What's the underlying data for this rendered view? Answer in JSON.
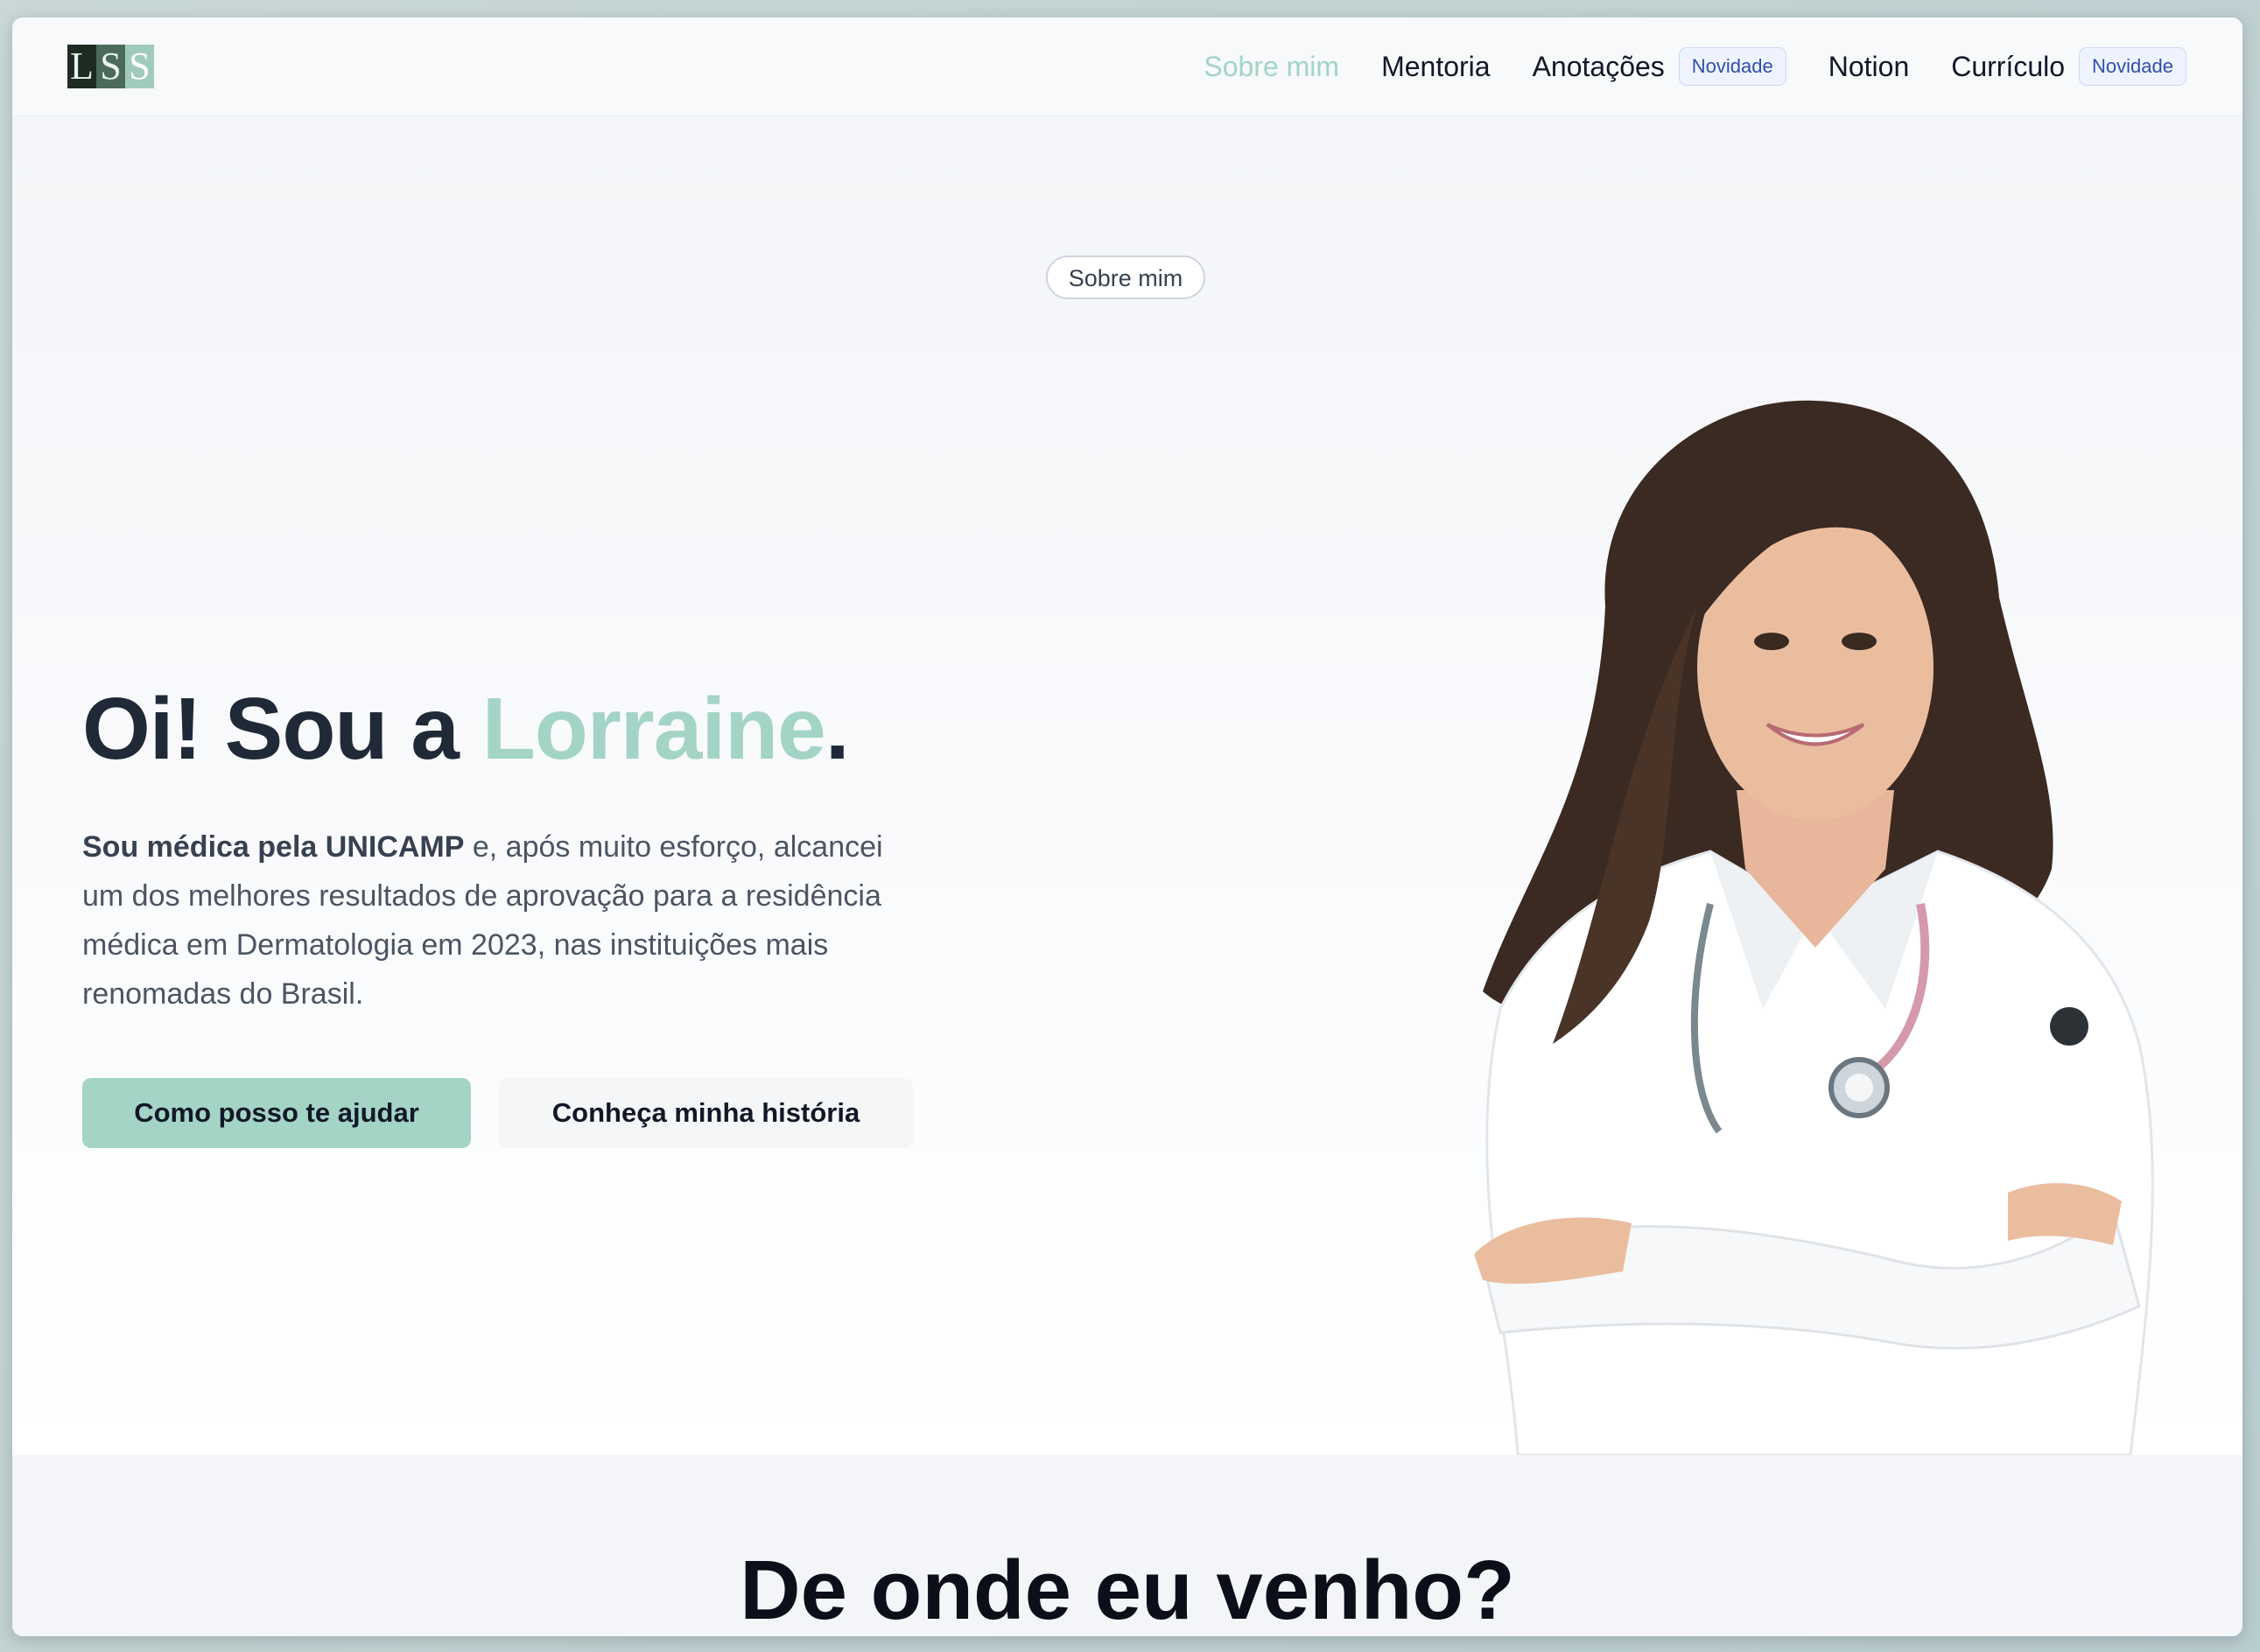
{
  "nav": {
    "logo_letters": [
      "L",
      "S",
      "S"
    ],
    "items": [
      {
        "label": "Sobre mim",
        "active": true
      },
      {
        "label": "Mentoria"
      },
      {
        "label": "Anotações",
        "badge": "Novidade"
      },
      {
        "label": "Notion"
      },
      {
        "label": "Currículo",
        "badge": "Novidade"
      }
    ]
  },
  "hero": {
    "pill": "Sobre mim",
    "headline_prefix": "Oi! Sou a ",
    "headline_name": "Lorraine",
    "headline_suffix": ".",
    "intro_bold": "Sou médica pela UNICAMP",
    "intro_rest": " e, após muito esforço, alcancei um dos melhores resultados de aprovação para a residência médica em Dermatologia em 2023, nas instituições mais renomadas do Brasil.",
    "primary_button": "Como posso te ajudar",
    "secondary_button": "Conheça minha história",
    "photo_icon": "doctor-portrait-photo"
  },
  "section2": {
    "title": "De onde eu venho?"
  },
  "colors": {
    "accent": "#a3d4c6",
    "text_dark": "#1f2937",
    "badge_text": "#2f4fa8"
  }
}
